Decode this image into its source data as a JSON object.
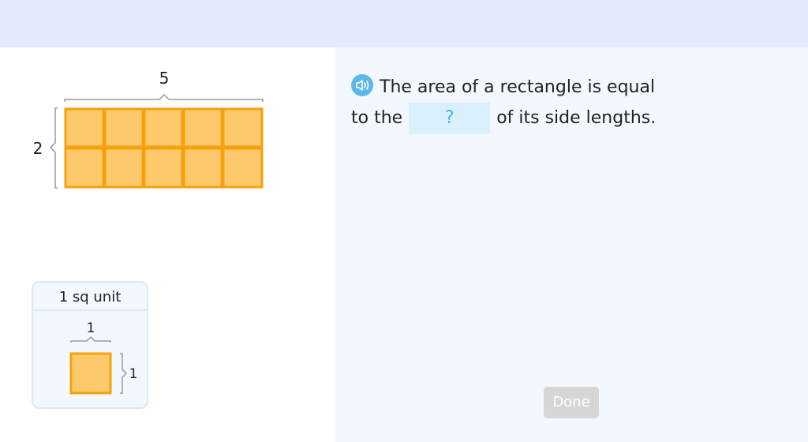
{
  "diagram": {
    "width_label": "5",
    "height_label": "2",
    "rows": 2,
    "cols": 5,
    "fill_color": "#fec96a",
    "stroke_color": "#f6a10c"
  },
  "legend": {
    "title": "1 sq unit",
    "side_top_label": "1",
    "side_right_label": "1"
  },
  "question": {
    "audio_icon": "speaker-icon",
    "text_part1": "The area of a rectangle is equal",
    "text_part2": "to the",
    "blank_placeholder": "?",
    "text_part3": "of its side lengths."
  },
  "done_label": "Done",
  "colors": {
    "topbar": "#e2eafb",
    "right_pane": "#f3f7fe",
    "blank_bg": "#dbf0fd",
    "accent": "#3db3e8",
    "done_disabled": "#d6d6d6"
  }
}
